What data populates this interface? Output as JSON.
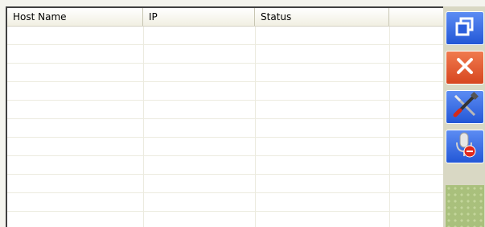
{
  "listview": {
    "columns": [
      {
        "label": "Host Name"
      },
      {
        "label": "IP"
      },
      {
        "label": "Status"
      },
      {
        "label": ""
      }
    ],
    "rows": []
  },
  "toolbar": {
    "buttons": [
      {
        "icon": "restore-window-icon",
        "color": "#2f62e0"
      },
      {
        "icon": "close-icon",
        "color": "#e2572b"
      },
      {
        "icon": "tools-icon",
        "color": "#2f62e0"
      },
      {
        "icon": "microphone-muted-icon",
        "color": "#2f62e0"
      }
    ]
  }
}
